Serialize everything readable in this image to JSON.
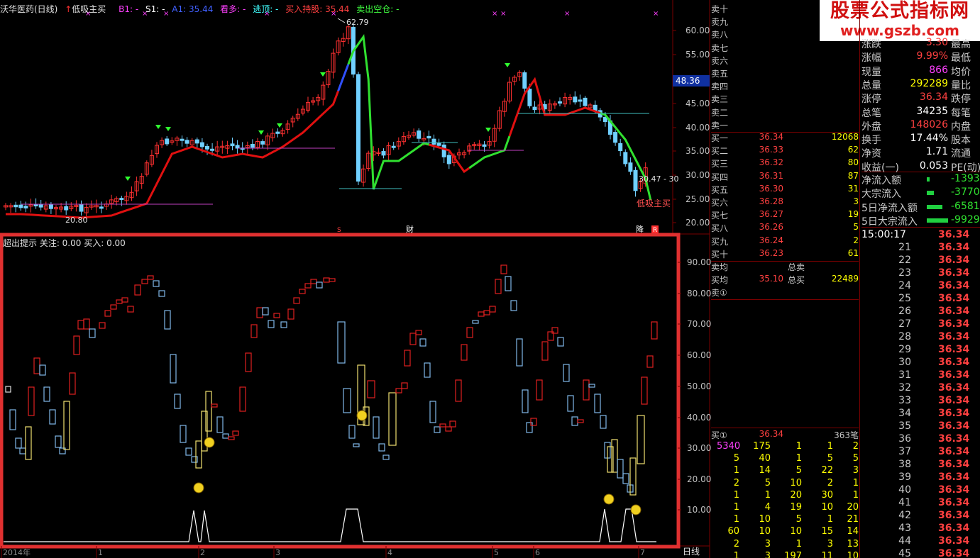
{
  "header": {
    "stock": "沃华医药(日线)",
    "arrow_label": "低吸主买",
    "b1": "B1: -",
    "s1": "S1: -",
    "a1": "A1: 35.44",
    "kandu": "看多: -",
    "taoding": "逃顶: -",
    "buy_hold": "买入持股: 35.44",
    "sell_clear": "卖出空仓: -"
  },
  "watermark": {
    "line1": "股票公式指标网",
    "line2": "www.gszb.com"
  },
  "main_chart": {
    "y_ticks": [
      "60.00",
      "55.00",
      "50.00",
      "45.00",
      "40.00",
      "35.00",
      "30.00",
      "25.00",
      "20.00"
    ],
    "current_price_tag": "48.36",
    "high_label": "62.79",
    "low_label": "20.80",
    "range_label": "30.47 - 30",
    "buy_label": "低吸主买",
    "marker_cai": "财",
    "marker_jiang": "降",
    "marker_r": "R",
    "marker_s": "S"
  },
  "sub_chart": {
    "title": "超出提示 关注: 0.00 买入: 0.00",
    "y_ticks": [
      "90.00",
      "80.00",
      "70.00",
      "60.00",
      "50.00",
      "40.00",
      "30.00",
      "20.00",
      "10.00"
    ]
  },
  "x_axis": {
    "labels": [
      "2014年",
      "1",
      "2",
      "3",
      "4",
      "5",
      "6",
      "7"
    ],
    "period": "日线"
  },
  "sell_book": [
    {
      "label": "卖十"
    },
    {
      "label": "卖九"
    },
    {
      "label": "卖八"
    },
    {
      "label": "卖七"
    },
    {
      "label": "卖六"
    },
    {
      "label": "卖五"
    },
    {
      "label": "卖四"
    },
    {
      "label": "卖三"
    },
    {
      "label": "卖二"
    },
    {
      "label": "卖一"
    }
  ],
  "buy_book": [
    {
      "label": "买一",
      "price": "36.34",
      "vol": "12068"
    },
    {
      "label": "买二",
      "price": "36.33",
      "vol": "62"
    },
    {
      "label": "买三",
      "price": "36.32",
      "vol": "80"
    },
    {
      "label": "买四",
      "price": "36.31",
      "vol": "87"
    },
    {
      "label": "买五",
      "price": "36.30",
      "vol": "31"
    },
    {
      "label": "买六",
      "price": "36.28",
      "vol": "3"
    },
    {
      "label": "买七",
      "price": "36.27",
      "vol": "19"
    },
    {
      "label": "买八",
      "price": "36.26",
      "vol": "5"
    },
    {
      "label": "买九",
      "price": "36.24",
      "vol": "2"
    },
    {
      "label": "买十",
      "price": "36.23",
      "vol": "61"
    }
  ],
  "avg": {
    "sell_label": "卖均",
    "total_sell": "总卖",
    "buy_label": "买均",
    "buy_avg": "35.10",
    "total_buy": "总买",
    "total_buy_val": "22489"
  },
  "sell1_label": "卖①",
  "buy1": {
    "label": "买①",
    "price": "36.34",
    "count": "363笔"
  },
  "stats": [
    {
      "a": "涨跌",
      "b": "3.30",
      "bc": "#ff4040",
      "c": "最高"
    },
    {
      "a": "涨幅",
      "b": "9.99%",
      "bc": "#ff4040",
      "c": "最低"
    },
    {
      "a": "现量",
      "b": "866",
      "bc": "#ff40ff",
      "c": "均价"
    },
    {
      "a": "总量",
      "b": "292289",
      "bc": "#ffff00",
      "c": "量比"
    },
    {
      "a": "涨停",
      "b": "36.34",
      "bc": "#ff4040",
      "c": "跌停"
    },
    {
      "a": "总笔",
      "b": "34235",
      "bc": "#ffffff",
      "c": "每笔"
    },
    {
      "a": "外盘",
      "b": "148026",
      "bc": "#ff4040",
      "c": "内盘"
    },
    {
      "a": "换手",
      "b": "17.44%",
      "bc": "#ffffff",
      "c": "股本"
    },
    {
      "a": "净资",
      "b": "1.71",
      "bc": "#ffffff",
      "c": "流通"
    },
    {
      "a": "收益(一)",
      "b": "0.053",
      "bc": "#ffffff",
      "c": "PE(动)"
    }
  ],
  "flows": [
    {
      "label": "净流入额",
      "val": "-1393"
    },
    {
      "label": "大宗流入",
      "val": "-3770"
    },
    {
      "label": "5日净流入额",
      "val": "-6581"
    },
    {
      "label": "5日大宗流入",
      "val": "-9929"
    }
  ],
  "ticks": [
    {
      "t": "15:00:17",
      "p": "36.34"
    },
    {
      "t": "21",
      "p": "36.34"
    },
    {
      "t": "22",
      "p": "36.34"
    },
    {
      "t": "23",
      "p": "36.34"
    },
    {
      "t": "24",
      "p": "36.34"
    },
    {
      "t": "25",
      "p": "36.34"
    },
    {
      "t": "26",
      "p": "36.34"
    },
    {
      "t": "27",
      "p": "36.34"
    },
    {
      "t": "28",
      "p": "36.34"
    },
    {
      "t": "29",
      "p": "36.34"
    },
    {
      "t": "30",
      "p": "36.34"
    },
    {
      "t": "31",
      "p": "36.34"
    },
    {
      "t": "32",
      "p": "36.34"
    },
    {
      "t": "33",
      "p": "36.34"
    },
    {
      "t": "34",
      "p": "36.34"
    },
    {
      "t": "35",
      "p": "36.34"
    },
    {
      "t": "36",
      "p": "36.34"
    },
    {
      "t": "37",
      "p": "36.34"
    },
    {
      "t": "38",
      "p": "36.34"
    },
    {
      "t": "39",
      "p": "36.34"
    },
    {
      "t": "40",
      "p": "36.34"
    },
    {
      "t": "41",
      "p": "36.34"
    },
    {
      "t": "42",
      "p": "36.34"
    },
    {
      "t": "43",
      "p": "36.34"
    },
    {
      "t": "44",
      "p": "36.34"
    },
    {
      "t": "45",
      "p": "36.34"
    }
  ],
  "trade_table": [
    [
      "5340",
      "175",
      "1",
      "1",
      "2"
    ],
    [
      "5",
      "40",
      "1",
      "5",
      "5"
    ],
    [
      "1",
      "14",
      "5",
      "22",
      "3"
    ],
    [
      "2",
      "5",
      "10",
      "2",
      "1"
    ],
    [
      "1",
      "1",
      "20",
      "30",
      "1"
    ],
    [
      "1",
      "4",
      "19",
      "10",
      "20"
    ],
    [
      "1",
      "10",
      "5",
      "1",
      "21"
    ],
    [
      "60",
      "10",
      "10",
      "15",
      "14"
    ],
    [
      "2",
      "3",
      "1",
      "3",
      "13"
    ],
    [
      "1",
      "3",
      "197",
      "11",
      "10"
    ]
  ],
  "trade_more": "....",
  "colors": {
    "up": "#ff3030",
    "down": "#70d0ff",
    "ma_up": "#e01010",
    "ma_down": "#30e030",
    "frame": "#e03030"
  }
}
